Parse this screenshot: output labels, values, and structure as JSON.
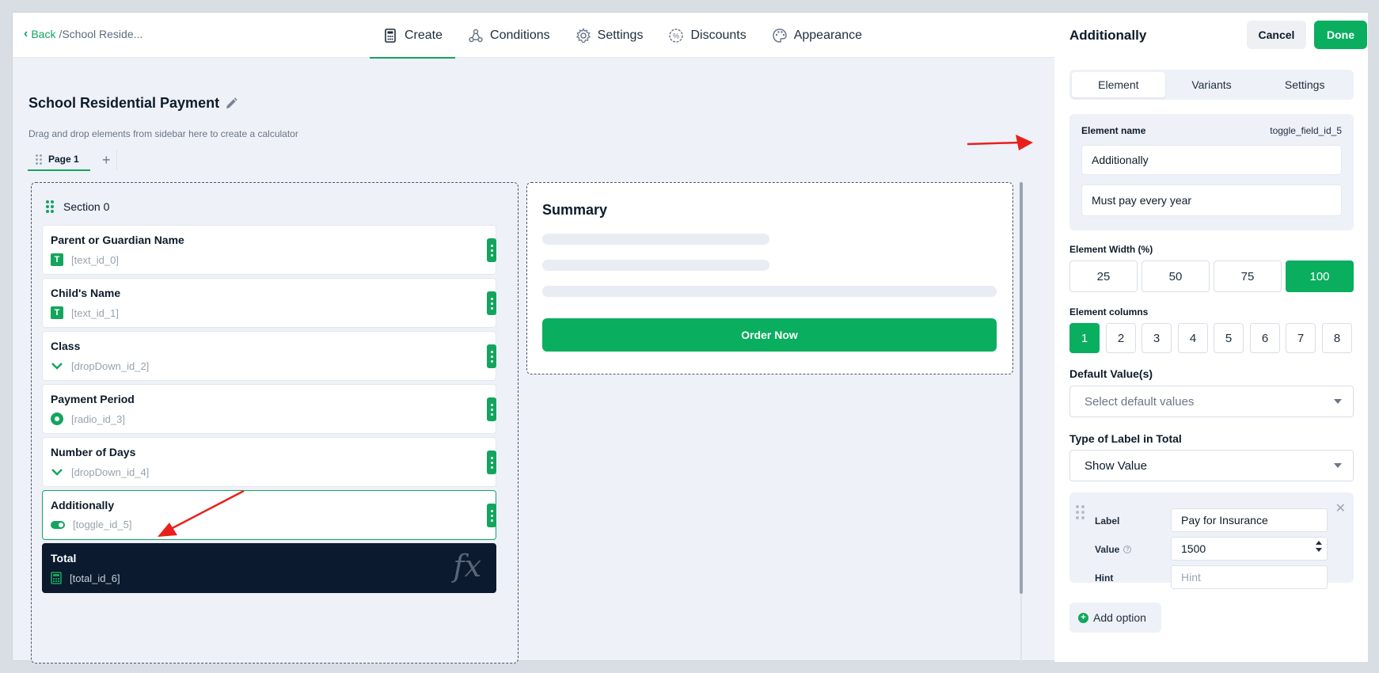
{
  "header": {
    "back_label": "Back",
    "breadcrumb": "School Reside...",
    "tabs": [
      {
        "label": "Create",
        "icon": "calculator-icon"
      },
      {
        "label": "Conditions",
        "icon": "conditions-icon"
      },
      {
        "label": "Settings",
        "icon": "gear-icon"
      },
      {
        "label": "Discounts",
        "icon": "percent-icon"
      },
      {
        "label": "Appearance",
        "icon": "palette-icon"
      }
    ]
  },
  "canvas": {
    "title": "School Residential Payment",
    "hint": "Drag and drop elements from sidebar here to create a calculator",
    "page_tab": "Page 1",
    "add_page": "+",
    "section_title": "Section 0",
    "fields": [
      {
        "name": "Parent or Guardian Name",
        "id": "[text_id_0]",
        "icon": "text-icon"
      },
      {
        "name": "Child's Name",
        "id": "[text_id_1]",
        "icon": "text-icon"
      },
      {
        "name": "Class",
        "id": "[dropDown_id_2]",
        "icon": "chevron-down-icon"
      },
      {
        "name": "Payment Period",
        "id": "[radio_id_3]",
        "icon": "radio-icon"
      },
      {
        "name": "Number of Days",
        "id": "[dropDown_id_4]",
        "icon": "chevron-down-icon"
      },
      {
        "name": "Additionally",
        "id": "[toggle_id_5]",
        "icon": "toggle-icon"
      },
      {
        "name": "Total",
        "id": "[total_id_6]",
        "icon": "calculator-icon",
        "badge": "fx"
      }
    ],
    "text_icon_glyph": "T"
  },
  "summary": {
    "title": "Summary",
    "order_button": "Order Now"
  },
  "panel": {
    "title": "Additionally",
    "cancel_label": "Cancel",
    "done_label": "Done",
    "tabs": [
      "Element",
      "Variants",
      "Settings"
    ],
    "element_name_label": "Element name",
    "element_id": "toggle_field_id_5",
    "element_name_value": "Additionally",
    "element_description_value": "Must pay every year",
    "width_label": "Element Width (%)",
    "width_options": [
      "25",
      "50",
      "75",
      "100"
    ],
    "width_selected": "100",
    "columns_label": "Element columns",
    "column_options": [
      "1",
      "2",
      "3",
      "4",
      "5",
      "6",
      "7",
      "8"
    ],
    "columns_selected": "1",
    "default_label": "Default Value(s)",
    "default_placeholder": "Select default values",
    "label_type_label": "Type of Label in Total",
    "label_type_value": "Show Value",
    "option": {
      "label_caption": "Label",
      "label_value": "Pay for Insurance",
      "value_caption": "Value",
      "value_value": "1500",
      "hint_caption": "Hint",
      "hint_placeholder": "Hint",
      "help_glyph": "?",
      "remove_glyph": "✕"
    },
    "add_option_label": "Add option",
    "add_option_glyph": "+"
  },
  "colors": {
    "accent": "#13a55e",
    "button_green": "#0aae5f",
    "dark": "#0b1a2e",
    "arrow": "#e8201c"
  }
}
